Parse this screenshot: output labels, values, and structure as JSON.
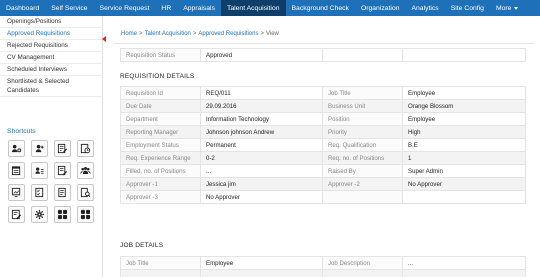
{
  "nav": {
    "items": [
      "Dashboard",
      "Self Service",
      "Service Request",
      "HR",
      "Appraisals",
      "Talent Acquisition",
      "Background Check",
      "Organization",
      "Analytics",
      "Site Config",
      "More"
    ],
    "active": "Talent Acquisition",
    "colors": {
      "bar": "#1e71b8",
      "active": "#0e3f6a"
    }
  },
  "sidebar": {
    "items": [
      "Openings/Positions",
      "Approved Requisitions",
      "Rejected Requisitions",
      "CV Management",
      "Scheduled Interviews",
      "Shortlisted & Selected Candidates"
    ],
    "shortcuts_title": "Shortcuts",
    "shortcut_icons": [
      "users-gear-icon",
      "person-add-icon",
      "edit-doc-icon",
      "clock-icon",
      "calendar-edit-icon",
      "person-card-icon",
      "document-edit-icon",
      "team-icon",
      "chart-edit-icon",
      "checklist-icon",
      "report-icon",
      "search-doc-icon",
      "edit-icon",
      "gear-icon",
      "grid-icon",
      "grid-icon"
    ]
  },
  "breadcrumb": {
    "home": "Home",
    "section": "Talent Acquisition",
    "page": "Approved Requisitions",
    "current": "View",
    "sep": ">"
  },
  "status": {
    "label": "Requisition Status",
    "value": "Approved"
  },
  "requisition_details": {
    "title": "REQUISITION DETAILS",
    "rows": [
      [
        "Requisition Id",
        "REQ/011",
        "Job Title",
        "Employee"
      ],
      [
        "Due Date",
        "29.09.2016",
        "Business Unit",
        "Orange Blossom"
      ],
      [
        "Department",
        "Information Technology",
        "Position",
        "Employee"
      ],
      [
        "Reporting Manager",
        "Johnson johnson Andrew",
        "Priority",
        "High"
      ],
      [
        "Employment Status",
        "Permanent",
        "Req. Qualification",
        "B.E"
      ],
      [
        "Req. Experience Range",
        "0-2",
        "Req. no. of Positions",
        "1"
      ],
      [
        "Filled. no. of Positions",
        "...",
        "Raised By",
        "Super Admin"
      ],
      [
        "Approver -1",
        "Jessica jim",
        "Approver -2",
        "No Approver"
      ],
      [
        "Approver -3",
        "No Approver",
        "",
        ""
      ]
    ]
  },
  "job_details": {
    "title": "JOB DETAILS",
    "rows": [
      [
        "Job Title",
        "Employee",
        "Job Description",
        "..."
      ]
    ]
  }
}
